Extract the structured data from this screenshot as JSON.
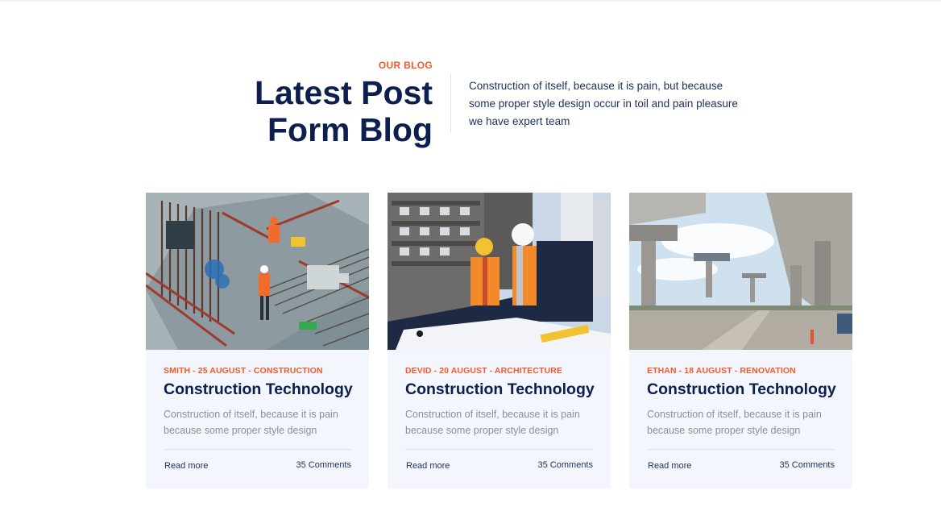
{
  "section": {
    "eyebrow": "OUR BLOG",
    "title_line1": "Latest Post",
    "title_line2": "Form Blog",
    "lead": "Construction of itself, because it is pain, but because some proper style design occur in toil and pain pleasure we have expert team"
  },
  "colors": {
    "accent": "#f1592a",
    "navy": "#0c1f4e",
    "card_bg": "#f3f7fd"
  },
  "posts": [
    {
      "meta": "SMITH - 25 AUGUST - CONSTRUCTION",
      "title": "Construction Technology",
      "excerpt": "Construction of itself, because it is pain because some proper style design",
      "read_more": "Read more",
      "comments": "35 Comments",
      "image": "rebar-site-workers-photo"
    },
    {
      "meta": "DEVID - 20 AUGUST - ARCHITECTURE",
      "title": "Construction Technology",
      "excerpt": "Construction of itself, because it is pain because some proper style design",
      "read_more": "Read more",
      "comments": "35 Comments",
      "image": "engineers-reviewing-plans-photo"
    },
    {
      "meta": "ETHAN - 18 AUGUST - RENOVATION",
      "title": "Construction Technology",
      "excerpt": "Construction of itself, because it is pain because some proper style design",
      "read_more": "Read more",
      "comments": "35 Comments",
      "image": "bridge-construction-photo"
    }
  ]
}
